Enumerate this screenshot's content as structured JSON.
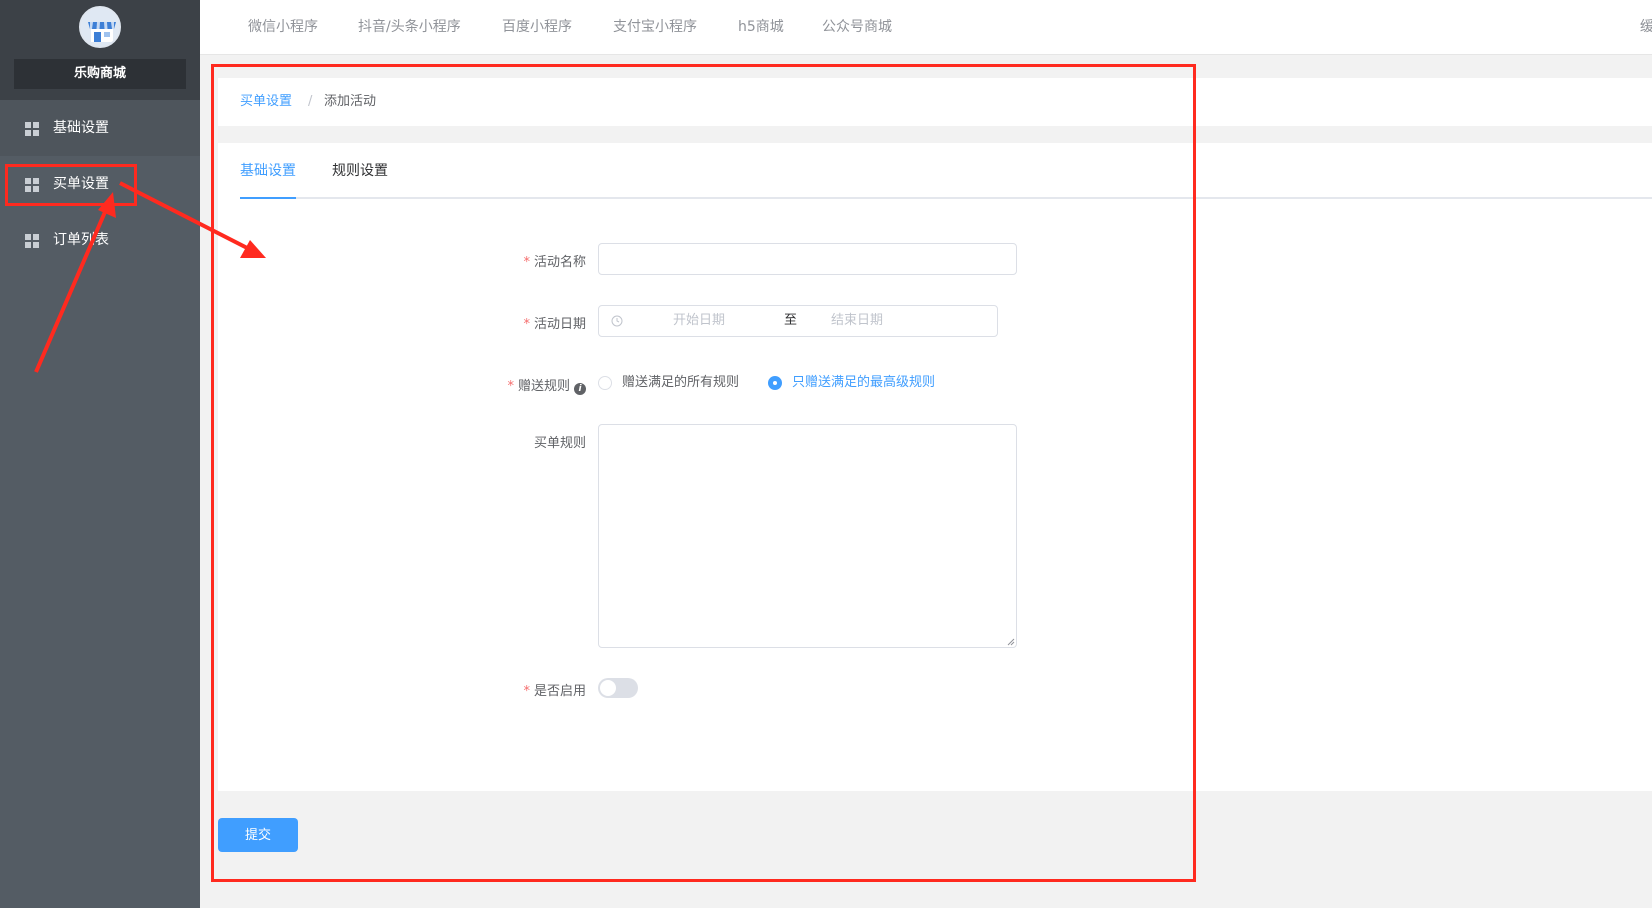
{
  "sidebar": {
    "shop_name": "乐购商城",
    "items": [
      {
        "label": "基础设置",
        "icon": "grid-icon"
      },
      {
        "label": "买单设置",
        "icon": "grid-icon"
      },
      {
        "label": "订单列表",
        "icon": "grid-icon"
      }
    ]
  },
  "topbar": {
    "tabs": [
      "微信小程序",
      "抖音/头条小程序",
      "百度小程序",
      "支付宝小程序",
      "h5商城",
      "公众号商城"
    ],
    "cut_text": "缓"
  },
  "breadcrumb": {
    "parent": "买单设置",
    "separator": "/",
    "current": "添加活动"
  },
  "form_tabs": {
    "tabs": [
      "基础设置",
      "规则设置"
    ],
    "active": 0
  },
  "form": {
    "required_mark": "*",
    "activity_name": {
      "label": "活动名称",
      "value": ""
    },
    "activity_date": {
      "label": "活动日期",
      "start_placeholder": "开始日期",
      "end_placeholder": "结束日期",
      "separator": "至"
    },
    "gift_rule": {
      "label": "赠送规则",
      "info_icon": "i",
      "options": [
        "赠送满足的所有规则",
        "只赠送满足的最高级规则"
      ],
      "selected": 1
    },
    "order_rule": {
      "label": "买单规则",
      "value": ""
    },
    "enabled": {
      "label": "是否启用",
      "value": false
    }
  },
  "submit_label": "提交",
  "colors": {
    "primary": "#409eff",
    "sidebar_bg": "#545c64",
    "annotation": "#ff2a1f",
    "required": "#f56c6c"
  }
}
